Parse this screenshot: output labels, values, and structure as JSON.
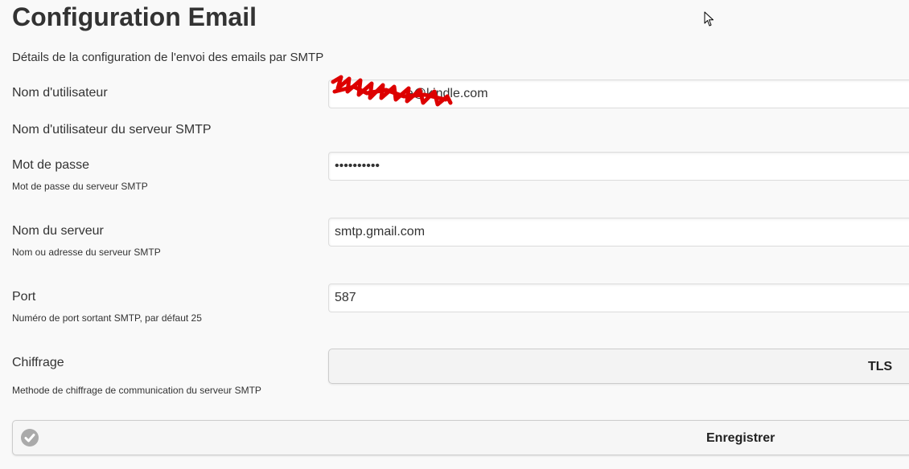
{
  "page": {
    "title": "Configuration Email",
    "subtitle": "Détails de la configuration de l'envoi des emails par SMTP"
  },
  "fields": {
    "username": {
      "label": "Nom d'utilisateur",
      "value": "                    e@kindle.com",
      "help": "Nom d'utilisateur du serveur SMTP"
    },
    "password": {
      "label": "Mot de passe",
      "value": "••••••••••",
      "help": "Mot de passe du serveur SMTP"
    },
    "server": {
      "label": "Nom du serveur",
      "value": "smtp.gmail.com",
      "help": "Nom ou adresse du serveur SMTP"
    },
    "port": {
      "label": "Port",
      "value": "587",
      "help": "Numéro de port sortant SMTP, par défaut 25"
    },
    "encryption": {
      "label": "Chiffrage",
      "selected": "TLS",
      "help": "Methode de chiffrage de communication du serveur SMTP"
    }
  },
  "actions": {
    "save_label": "Enregistrer",
    "save_icon": "check-circle-icon"
  },
  "colors": {
    "redaction": "#dd0000",
    "text": "#333333"
  }
}
